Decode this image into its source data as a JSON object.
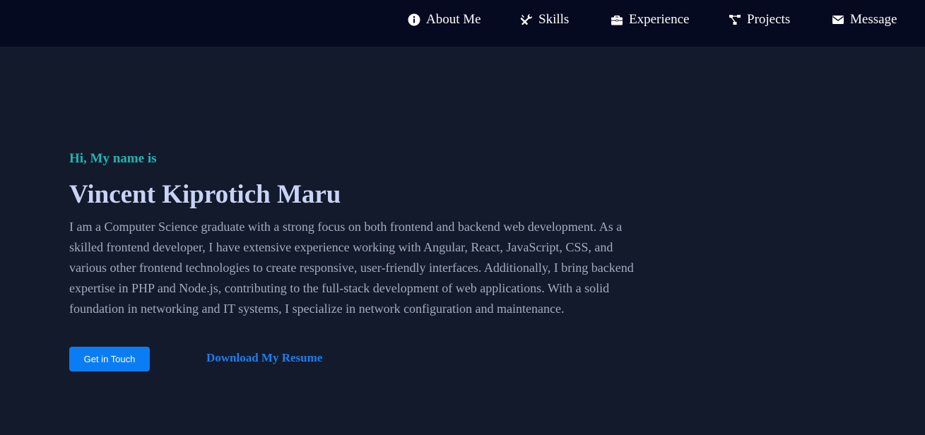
{
  "nav": {
    "items": [
      {
        "label": "About Me",
        "icon": "info-circle-icon"
      },
      {
        "label": "Skills",
        "icon": "tools-icon"
      },
      {
        "label": "Experience",
        "icon": "briefcase-icon"
      },
      {
        "label": "Projects",
        "icon": "project-diagram-icon"
      },
      {
        "label": "Message",
        "icon": "envelope-icon"
      }
    ]
  },
  "hero": {
    "greeting": "Hi, My name is",
    "name": "Vincent Kiprotich Maru",
    "bio": "I am a Computer Science graduate with a strong focus on both frontend and backend web development. As a skilled frontend developer, I have extensive experience working with Angular, React, JavaScript, CSS, and various other frontend technologies to create responsive, user-friendly interfaces. Additionally, I bring backend expertise in PHP and Node.js, contributing to the full-stack development of web applications. With a solid foundation in networking and IT systems, I specialize in network configuration and maintenance.",
    "primary_button": "Get in Touch",
    "resume_link": "Download My Resume"
  },
  "colors": {
    "navbar_bg": "#060a20",
    "page_bg": "#131a2b",
    "greeting": "#1fb5b0",
    "name": "#c8d3f5",
    "bio": "#a3acc0",
    "accent": "#0a7df5"
  }
}
